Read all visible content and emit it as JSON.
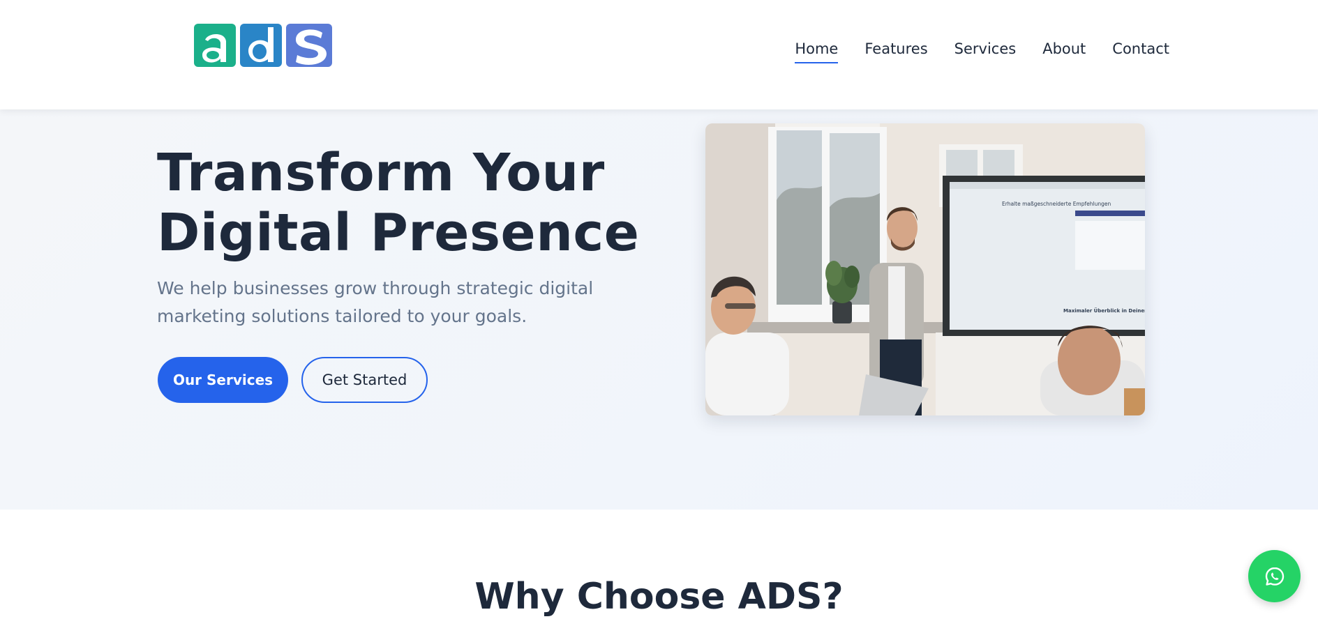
{
  "brand": {
    "logo_text": "ads",
    "colors": {
      "a": "#1bb08a",
      "d": "#2a85c7",
      "s": "#5b7bd6"
    }
  },
  "nav": {
    "items": [
      {
        "label": "Home",
        "active": true
      },
      {
        "label": "Features",
        "active": false
      },
      {
        "label": "Services",
        "active": false
      },
      {
        "label": "About",
        "active": false
      },
      {
        "label": "Contact",
        "active": false
      }
    ]
  },
  "hero": {
    "title_line1": "Transform Your",
    "title_line2": "Digital Presence",
    "subtitle": "We help businesses grow through strategic digital marketing solutions tailored to your goals.",
    "primary_button": "Our Services",
    "secondary_button": "Get Started",
    "image_alt": "Office meeting presentation",
    "screen_heading": "Erhalte maßgeschneiderte Empfehlungen",
    "screen_caption": "Maximaler Überblick in Deiner"
  },
  "why": {
    "title": "Why Choose ADS?"
  },
  "float": {
    "icon": "whatsapp-icon",
    "color": "#25d366"
  },
  "accent": "#2563eb"
}
